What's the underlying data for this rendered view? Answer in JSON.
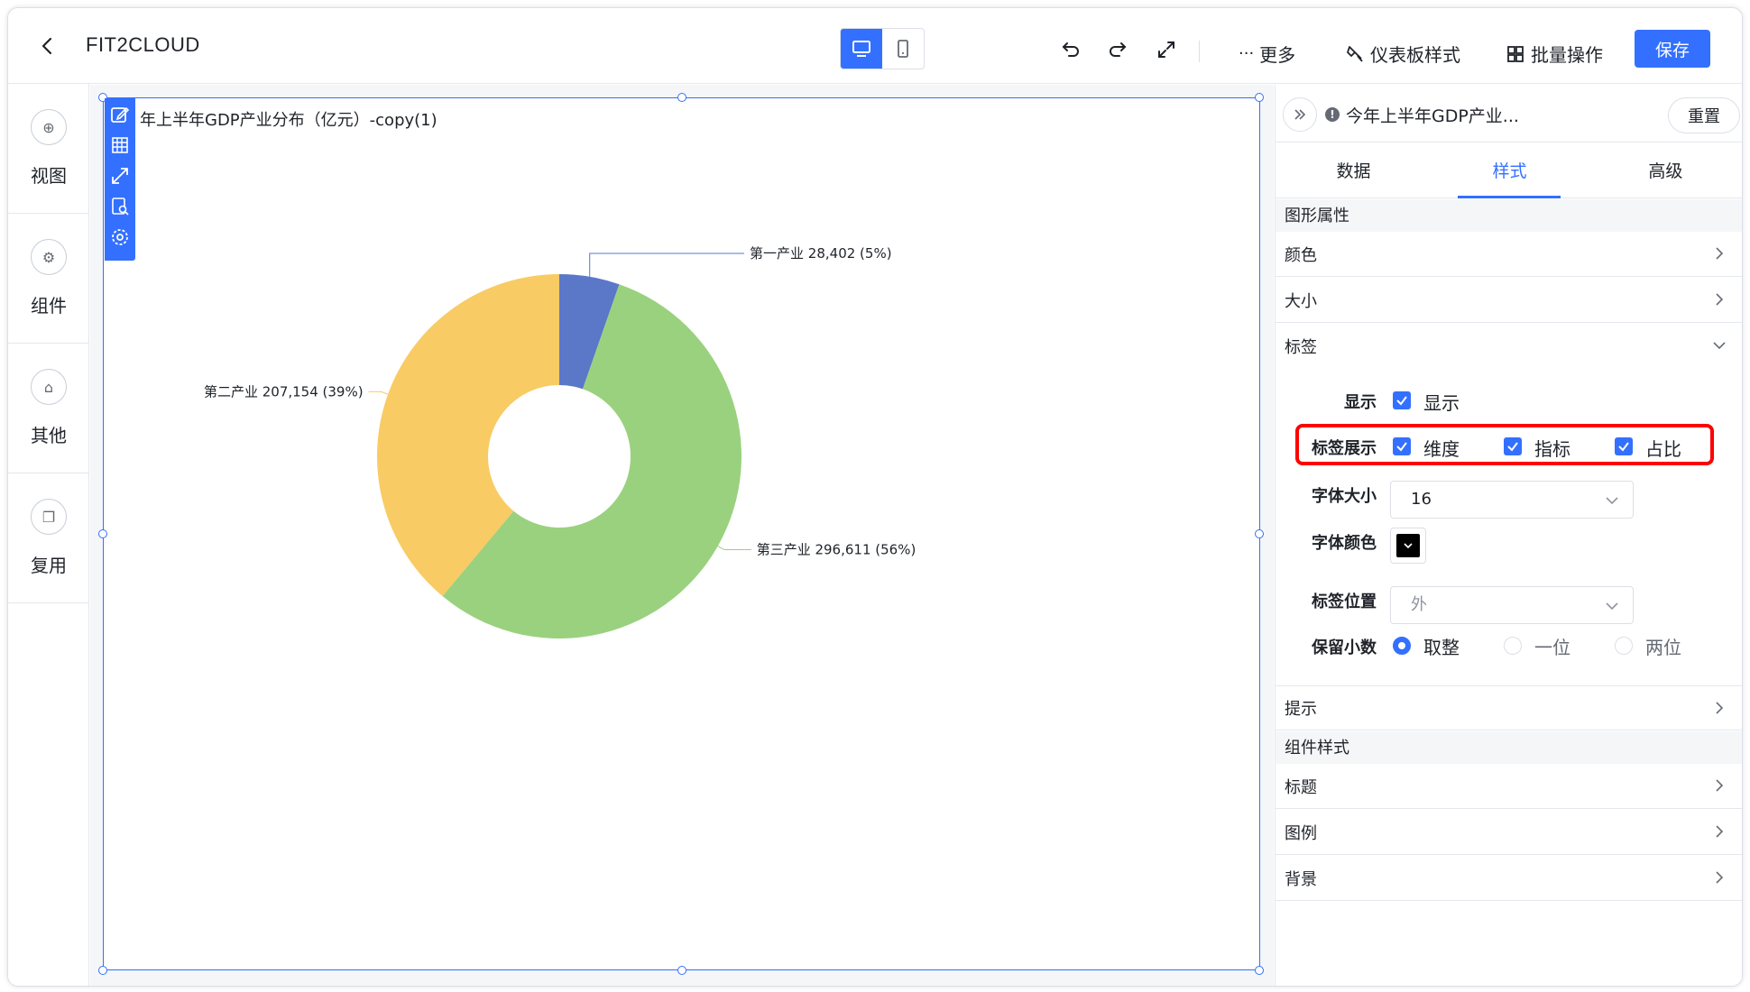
{
  "app": {
    "title": "FIT2CLOUD"
  },
  "toolbar": {
    "more": "更多",
    "dashboard_style": "仪表板样式",
    "batch": "批量操作",
    "save": "保存"
  },
  "sidebar": {
    "items": [
      {
        "label": "视图",
        "icon": "plus-circle-icon"
      },
      {
        "label": "组件",
        "icon": "gear-icon"
      },
      {
        "label": "其他",
        "icon": "box-icon"
      },
      {
        "label": "复用",
        "icon": "copy-icon"
      }
    ]
  },
  "chart": {
    "title": "年上半年GDP产业分布（亿元）-copy(1)",
    "labels": [
      "第一产业 28,402 (5%)",
      "第三产业 296,611 (56%)",
      "第二产业 207,154 (39%)"
    ]
  },
  "chart_data": {
    "type": "pie",
    "variant": "donut",
    "categories": [
      "第一产业",
      "第三产业",
      "第二产业"
    ],
    "values": [
      28402,
      296611,
      207154
    ],
    "percents": [
      "5%",
      "56%",
      "39%"
    ],
    "colors": [
      "#5b77c7",
      "#9ad17e",
      "#f8cb64"
    ],
    "legend": "none"
  },
  "panel": {
    "title": "今年上半年GDP产业...",
    "reset": "重置",
    "tabs": [
      "数据",
      "样式",
      "高级"
    ],
    "active_tab": "样式",
    "section_shape": "图形属性",
    "rows": {
      "color": "颜色",
      "size": "大小",
      "label": "标签",
      "tooltip": "提示"
    },
    "label_form": {
      "show_label": "显示",
      "show_value": "显示",
      "display_label": "标签展示",
      "opt_dimension": "维度",
      "opt_metric": "指标",
      "opt_ratio": "占比",
      "font_size_label": "字体大小",
      "font_size_value": "16",
      "font_color_label": "字体颜色",
      "font_color": "#000000",
      "position_label": "标签位置",
      "position_value": "外",
      "decimal_label": "保留小数",
      "decimal_opts": [
        "取整",
        "一位",
        "两位"
      ],
      "decimal_selected": "取整"
    },
    "section_component": "组件样式",
    "comp_rows": {
      "title": "标题",
      "legend": "图例",
      "background": "背景"
    }
  }
}
